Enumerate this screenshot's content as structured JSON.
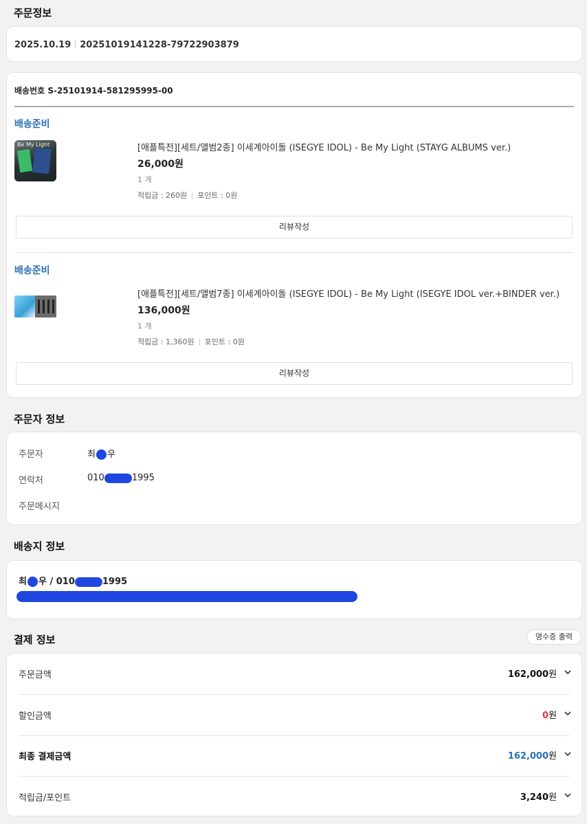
{
  "order_info": {
    "title": "주문정보",
    "date": "2025.10.19",
    "order_number": "20251019141228-79722903879"
  },
  "shipment": {
    "shipping_number": "배송번호 S-25101914-581295995-00",
    "items": [
      {
        "status": "배송준비",
        "thumb_label": "Be My Light",
        "name": "[애플특전][세트/앨범2종] 이세계아이돌 (ISEGYE IDOL) - Be My Light (STAYG ALBUMS ver.)",
        "price": "26,000원",
        "quantity": "1 개",
        "reward": "적립금 : 260원",
        "points": "포인트 : 0원",
        "review_button": "리뷰작성"
      },
      {
        "status": "배송준비",
        "name": "[애플특전][세트/앨범7종] 이세계아이돌 (ISEGYE IDOL) - Be My Light (ISEGYE IDOL ver.+BINDER ver.)",
        "price": "136,000원",
        "quantity": "1 개",
        "reward": "적립금 : 1,360원",
        "points": "포인트 : 0원",
        "review_button": "리뷰작성"
      }
    ]
  },
  "orderer": {
    "title": "주문자 정보",
    "name_label": "주문자",
    "name_prefix": "최",
    "name_suffix": "우",
    "phone_label": "연락처",
    "phone_prefix": "010",
    "phone_suffix": "1995",
    "message_label": "주문메시지"
  },
  "delivery": {
    "title": "배송지 정보",
    "recipient_prefix": "최",
    "recipient_middle": "우 / 010",
    "recipient_suffix": "1995"
  },
  "payment": {
    "title": "결제 정보",
    "receipt_button": "영수증 출력",
    "rows": [
      {
        "label": "주문금액",
        "amount": "162,000",
        "unit": "원"
      },
      {
        "label": "할인금액",
        "amount": "0",
        "unit": "원"
      },
      {
        "label": "최종 결제금액",
        "amount": "162,000",
        "unit": "원"
      },
      {
        "label": "적립금/포인트",
        "amount": "3,240",
        "unit": "원"
      }
    ]
  },
  "colors": {
    "status_blue": "#2a6fb5",
    "redaction_blue": "#1f47e0",
    "discount_red": "#d43b3b"
  }
}
